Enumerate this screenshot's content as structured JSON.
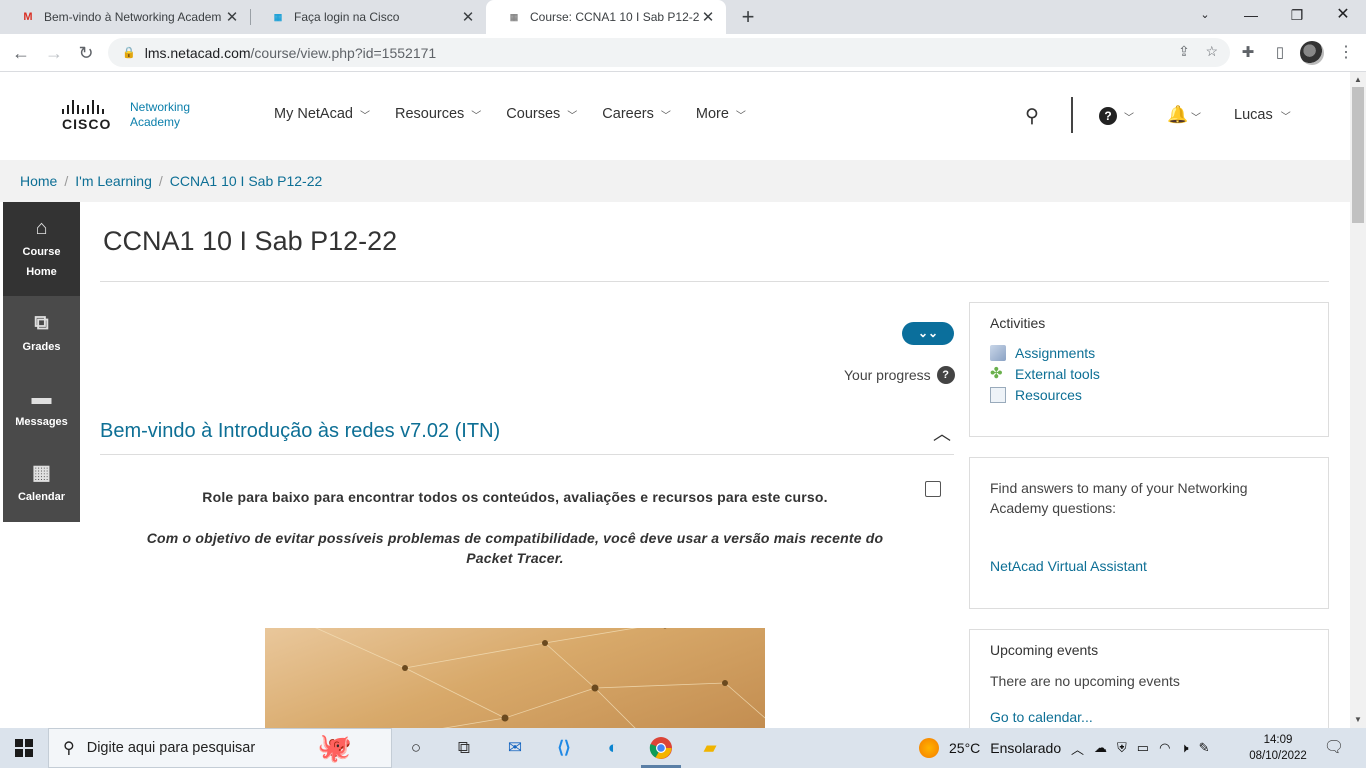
{
  "browser": {
    "tabs": [
      {
        "title": "Bem-vindo à Networking Academ",
        "favicon": "gmail-icon",
        "active": false
      },
      {
        "title": "Faça login na Cisco",
        "favicon": "cisco-icon",
        "active": false
      },
      {
        "title": "Course: CCNA1 10 I Sab P12-22",
        "favicon": "cisco-icon",
        "active": true
      }
    ],
    "url_host": "lms.netacad.com",
    "url_path": "/course/view.php?id=1552171"
  },
  "site": {
    "logo_line1": "Networking",
    "logo_line2": "Academy",
    "logo_wordmark": "CISCO",
    "nav": [
      "My NetAcad",
      "Resources",
      "Courses",
      "Careers",
      "More"
    ],
    "user": "Lucas"
  },
  "breadcrumb": [
    "Home",
    "I'm Learning",
    "CCNA1 10 I Sab P12-22"
  ],
  "sidenav": [
    {
      "label_line1": "Course",
      "label_line2": "Home",
      "icon": "home-icon"
    },
    {
      "label_line1": "Grades",
      "label_line2": "",
      "icon": "grades-icon"
    },
    {
      "label_line1": "Messages",
      "label_line2": "",
      "icon": "messages-icon"
    },
    {
      "label_line1": "Calendar",
      "label_line2": "",
      "icon": "calendar-icon"
    }
  ],
  "course": {
    "title": "CCNA1 10 I Sab P12-22",
    "progress_label": "Your progress",
    "section_title": "Bem-vindo à Introdução às redes v7.02 (ITN)",
    "intro_line": "Role para baixo para encontrar todos os conteúdos, avaliações e recursos para este curso.",
    "intro_italic": "Com o objetivo de evitar possíveis problemas de compatibilidade, você deve usar a versão mais recente do Packet Tracer."
  },
  "activities": {
    "heading": "Activities",
    "items": [
      "Assignments",
      "External tools",
      "Resources"
    ]
  },
  "faq": {
    "text": "Find answers to many of your Networking Academy questions:",
    "link": "NetAcad Virtual Assistant"
  },
  "events": {
    "heading": "Upcoming events",
    "empty": "There are no upcoming events",
    "link": "Go to calendar..."
  },
  "taskbar": {
    "search_placeholder": "Digite aqui para pesquisar",
    "weather_temp": "25°C",
    "weather_text": "Ensolarado",
    "time": "14:09",
    "date": "08/10/2022"
  },
  "colors": {
    "accent": "#0d6f95",
    "sidenav": "#4a4a4a",
    "pill": "#0b6f9c"
  }
}
